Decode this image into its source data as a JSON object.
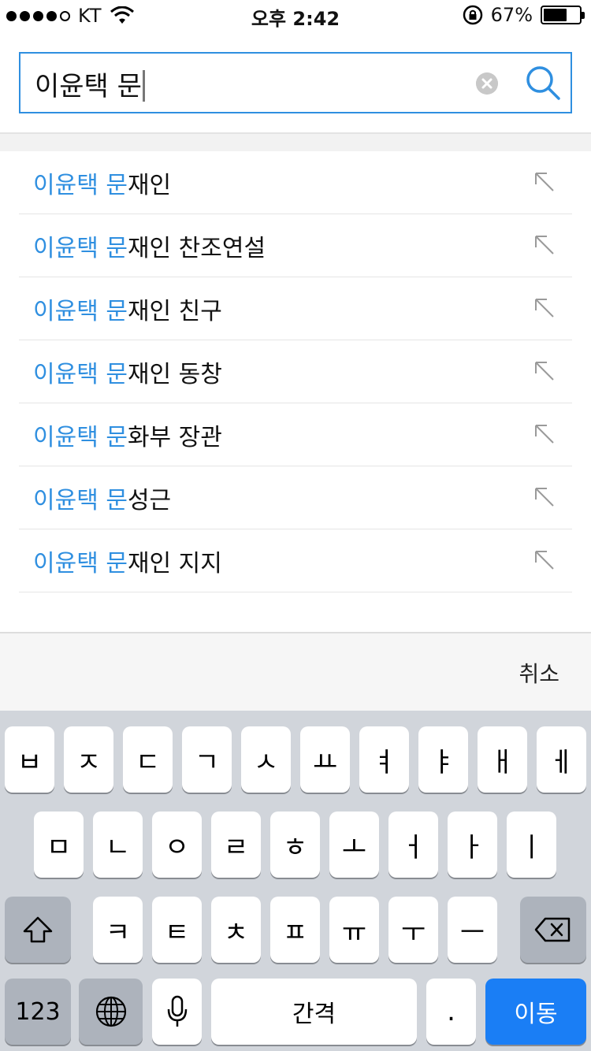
{
  "status_bar": {
    "carrier": "KT",
    "time": "오후 2:42",
    "battery_percent": "67%",
    "battery_level": 0.67
  },
  "search": {
    "query": "이윤택 문"
  },
  "suggestions": [
    {
      "prefix": "이윤택 문",
      "suffix": "재인"
    },
    {
      "prefix": "이윤택 문",
      "suffix": "재인 찬조연설"
    },
    {
      "prefix": "이윤택 문",
      "suffix": "재인 친구"
    },
    {
      "prefix": "이윤택 문",
      "suffix": "재인 동창"
    },
    {
      "prefix": "이윤택 문",
      "suffix": "화부 장관"
    },
    {
      "prefix": "이윤택 문",
      "suffix": "성근"
    },
    {
      "prefix": "이윤택 문",
      "suffix": "재인 지지"
    }
  ],
  "cancel_label": "취소",
  "keyboard": {
    "row1": [
      "ㅂ",
      "ㅈ",
      "ㄷ",
      "ㄱ",
      "ㅅ",
      "ㅛ",
      "ㅕ",
      "ㅑ",
      "ㅐ",
      "ㅔ"
    ],
    "row2": [
      "ㅁ",
      "ㄴ",
      "ㅇ",
      "ㄹ",
      "ㅎ",
      "ㅗ",
      "ㅓ",
      "ㅏ",
      "ㅣ"
    ],
    "row3": [
      "ㅋ",
      "ㅌ",
      "ㅊ",
      "ㅍ",
      "ㅠ",
      "ㅜ",
      "ㅡ"
    ],
    "numbers_label": "123",
    "space_label": "간격",
    "period_label": ".",
    "go_label": "이동",
    "shift_icon": "shift-icon",
    "backspace_icon": "backspace-icon",
    "globe_icon": "globe-icon",
    "mic_icon": "microphone-icon"
  },
  "colors": {
    "accent": "#2f8fe0",
    "go_key": "#1a7ef5",
    "keyboard_bg": "#d1d5db"
  }
}
